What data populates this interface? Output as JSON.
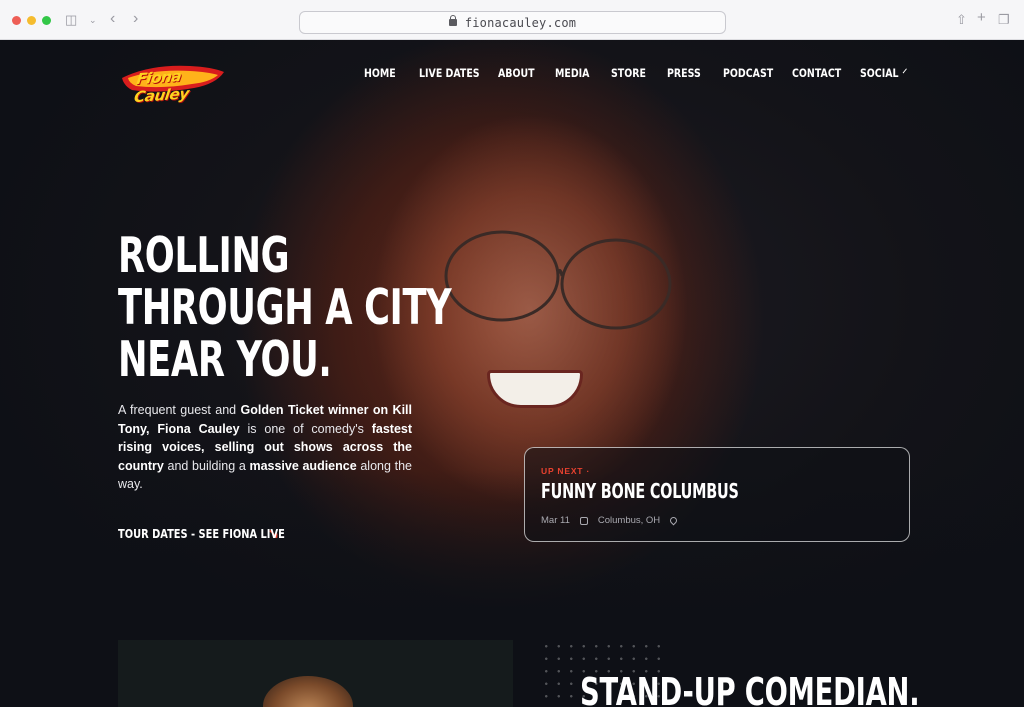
{
  "browser": {
    "url": "fionacauley.com",
    "traffic_lights": [
      "#ee5e56",
      "#f5bc2f",
      "#33c748"
    ]
  },
  "site": {
    "logo_text": "Fiona Cauley",
    "nav": [
      {
        "label": "HOME"
      },
      {
        "label": "LIVE DATES"
      },
      {
        "label": "ABOUT"
      },
      {
        "label": "MEDIA"
      },
      {
        "label": "STORE"
      },
      {
        "label": "PRESS"
      },
      {
        "label": "PODCAST"
      },
      {
        "label": "CONTACT"
      },
      {
        "label": "SOCIAL",
        "has_dropdown": true
      }
    ]
  },
  "hero": {
    "headline_lines": [
      "ROLLING",
      "THROUGH A CITY",
      "NEAR YOU."
    ],
    "intro": {
      "t1": "A frequent guest and ",
      "b1": "Golden Ticket winner on Kill Tony, Fiona Cauley",
      "t2": " is one of comedy's ",
      "b2": "fastest rising voices, selling out shows across the country",
      "t3": " and building a ",
      "b3": "massive audience",
      "t4": " along the way."
    },
    "cta": {
      "label": "TOUR DATES - SEE FIONA LIVE",
      "icon": "arrow-down-right-icon"
    }
  },
  "up_next": {
    "kicker": "UP NEXT ·",
    "title": "FUNNY BONE COLUMBUS",
    "date": "Mar 11",
    "location": "Columbus, OH"
  },
  "section2": {
    "heading": "STAND-UP COMEDIAN."
  },
  "colors": {
    "accent": "#e8412f",
    "background": "#0e1016"
  }
}
